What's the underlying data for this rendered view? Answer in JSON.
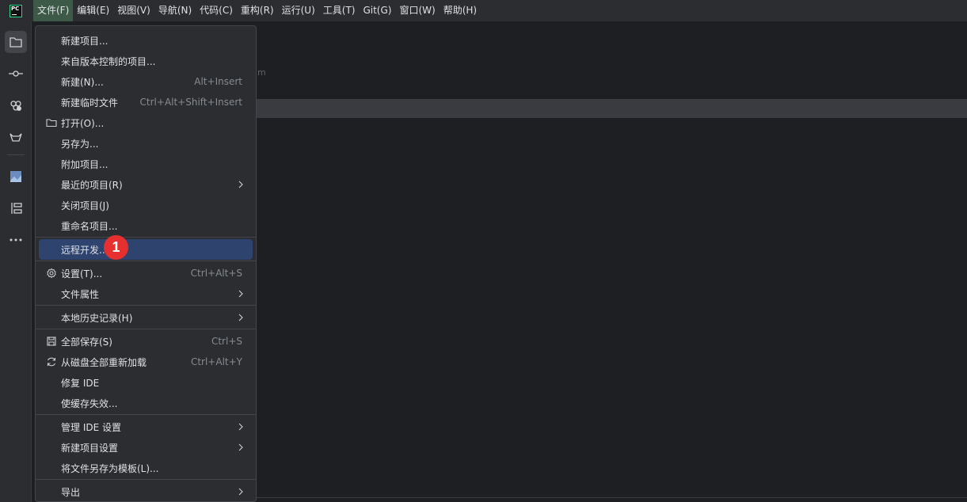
{
  "app": {
    "logo_text": "PC"
  },
  "menubar": {
    "items": [
      {
        "label": "文件(F)"
      },
      {
        "label": "编辑(E)"
      },
      {
        "label": "视图(V)"
      },
      {
        "label": "导航(N)"
      },
      {
        "label": "代码(C)"
      },
      {
        "label": "重构(R)"
      },
      {
        "label": "运行(U)"
      },
      {
        "label": "工具(T)"
      },
      {
        "label": "Git(G)"
      },
      {
        "label": "窗口(W)"
      },
      {
        "label": "帮助(H)"
      }
    ]
  },
  "toolstrip": {
    "icons": [
      "project-folder-icon",
      "commit-icon",
      "services-icon",
      "gitlab-icon",
      "image-viewer-icon",
      "structure-icon",
      "more-icon"
    ]
  },
  "background": {
    "hint_text": "m"
  },
  "file_menu": {
    "items": [
      {
        "label": "新建项目...",
        "shortcut": ""
      },
      {
        "label": "来自版本控制的项目...",
        "shortcut": ""
      },
      {
        "label": "新建(N)...",
        "shortcut": "Alt+Insert"
      },
      {
        "label": "新建临时文件",
        "shortcut": "Ctrl+Alt+Shift+Insert"
      },
      {
        "label": "打开(O)...",
        "shortcut": "",
        "icon": "folder-icon"
      },
      {
        "label": "另存为...",
        "shortcut": ""
      },
      {
        "label": "附加项目...",
        "shortcut": ""
      },
      {
        "label": "最近的项目(R)",
        "shortcut": "",
        "submenu": true
      },
      {
        "label": "关闭项目(J)",
        "shortcut": ""
      },
      {
        "label": "重命名项目...",
        "shortcut": ""
      },
      {
        "label": "远程开发...",
        "shortcut": "",
        "highlighted": true
      },
      {
        "label": "设置(T)...",
        "shortcut": "Ctrl+Alt+S",
        "icon": "gear-icon"
      },
      {
        "label": "文件属性",
        "shortcut": "",
        "submenu": true
      },
      {
        "label": "本地历史记录(H)",
        "shortcut": "",
        "submenu": true
      },
      {
        "label": "全部保存(S)",
        "shortcut": "Ctrl+S",
        "icon": "save-icon"
      },
      {
        "label": "从磁盘全部重新加载",
        "shortcut": "Ctrl+Alt+Y",
        "icon": "reload-icon"
      },
      {
        "label": "修复 IDE",
        "shortcut": ""
      },
      {
        "label": "使缓存失效...",
        "shortcut": ""
      },
      {
        "label": "管理 IDE 设置",
        "shortcut": "",
        "submenu": true
      },
      {
        "label": "新建项目设置",
        "shortcut": "",
        "submenu": true
      },
      {
        "label": "将文件另存为模板(L)...",
        "shortcut": ""
      },
      {
        "label": "导出",
        "shortcut": "",
        "submenu": true
      }
    ]
  },
  "annotation": {
    "step_number": "1",
    "color": "#e5302f"
  },
  "colors": {
    "menu_bg": "#2b2d30",
    "highlight": "#2e436e",
    "active_menu": "#3c5a47"
  }
}
